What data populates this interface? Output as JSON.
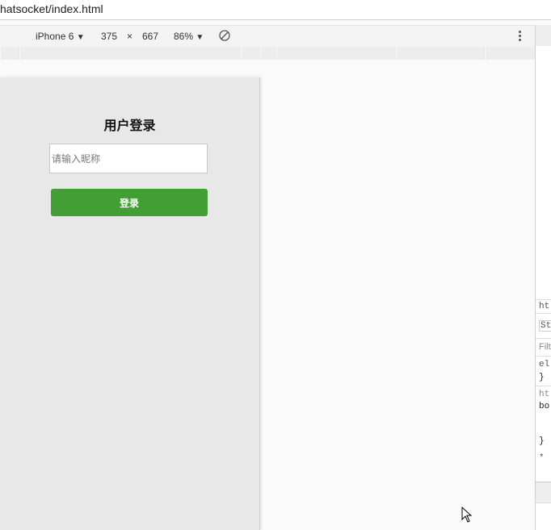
{
  "address_bar": {
    "url": "hatsocket/index.html"
  },
  "device_toolbar": {
    "device": "iPhone 6",
    "dropdown_arrow": "▼",
    "width": "375",
    "times": "×",
    "height": "667",
    "zoom": "86%",
    "zoom_arrow": "▼",
    "rotate_icon": "rotate-icon",
    "more_icon": "kebab-icon"
  },
  "page": {
    "title": "用户登录",
    "nickname_placeholder": "请输入昵称",
    "login_button": "登录",
    "colors": {
      "button": "#439e36",
      "viewport_bg": "#e8e8e8"
    }
  },
  "devtools": {
    "lines": [
      "ht",
      "St",
      "Filt",
      "el",
      "}",
      "ht",
      "bo",
      "}",
      "*"
    ]
  }
}
